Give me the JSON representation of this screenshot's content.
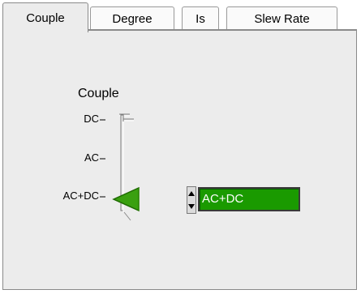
{
  "tabs": [
    {
      "label": "Couple",
      "active": true
    },
    {
      "label": "Degree",
      "active": false
    },
    {
      "label": "Is",
      "active": false
    },
    {
      "label": "Slew Rate",
      "active": false
    }
  ],
  "slider": {
    "title": "Couple",
    "ticks": [
      "DC",
      "AC",
      "AC+DC"
    ],
    "selected": "AC+DC"
  },
  "value_field": {
    "value": "AC+DC",
    "background": "#1a9a00",
    "text_color": "#ffffff"
  },
  "slider_thumb_color": "#3aa010"
}
